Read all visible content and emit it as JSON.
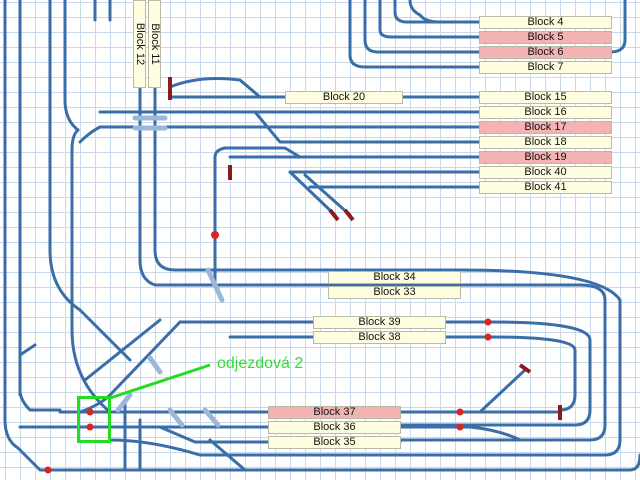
{
  "layout_blocks": {
    "b4": {
      "label": "Block 4",
      "occupied": false
    },
    "b5": {
      "label": "Block 5",
      "occupied": true
    },
    "b6": {
      "label": "Block 6",
      "occupied": true
    },
    "b7": {
      "label": "Block 7",
      "occupied": false
    },
    "b20": {
      "label": "Block 20",
      "occupied": false
    },
    "b15": {
      "label": "Block 15",
      "occupied": false
    },
    "b16": {
      "label": "Block 16",
      "occupied": false
    },
    "b17": {
      "label": "Block 17",
      "occupied": true
    },
    "b18": {
      "label": "Block 18",
      "occupied": false
    },
    "b19": {
      "label": "Block 19",
      "occupied": true
    },
    "b40": {
      "label": "Block 40",
      "occupied": false
    },
    "b41": {
      "label": "Block 41",
      "occupied": false
    },
    "b34": {
      "label": "Block 34",
      "occupied": false
    },
    "b33": {
      "label": "Block 33",
      "occupied": false
    },
    "b39": {
      "label": "Block 39",
      "occupied": false
    },
    "b38": {
      "label": "Block 38",
      "occupied": false
    },
    "b37": {
      "label": "Block 37",
      "occupied": true
    },
    "b36": {
      "label": "Block 36",
      "occupied": false
    },
    "b35": {
      "label": "Block 35",
      "occupied": false
    },
    "b11": {
      "label": "Block 11",
      "occupied": false
    },
    "b12": {
      "label": "Block 12",
      "occupied": false
    }
  },
  "annotation": {
    "text": "odjezdová 2"
  },
  "colors": {
    "track": "#3a6ea8",
    "track_light": "#9bb8d8",
    "grid": "#c9d9ec",
    "block_free": "#fffde0",
    "block_occupied": "#f4b3b3",
    "signal_red": "#dd2222",
    "buffer": "#8b1a1a",
    "annotation": "#22dd22"
  }
}
